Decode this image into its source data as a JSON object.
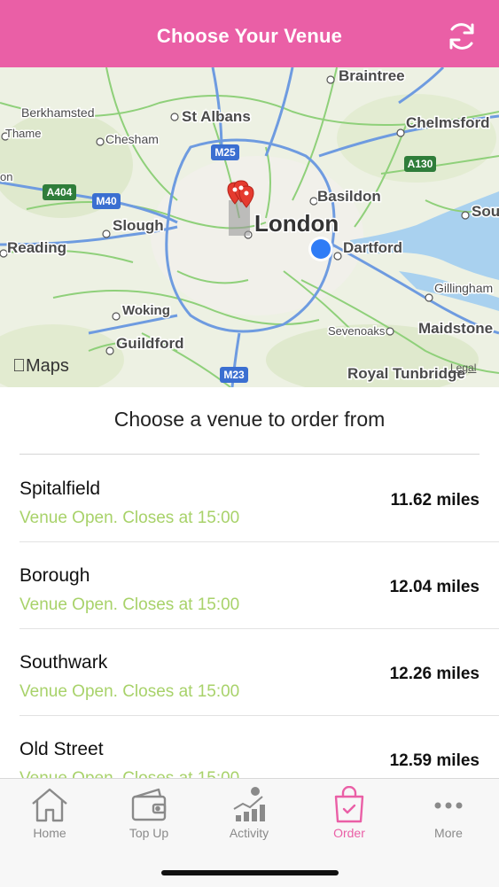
{
  "header": {
    "title": "Choose Your Venue",
    "refresh_icon": "refresh-icon"
  },
  "map": {
    "attribution": "Maps",
    "legal": "Legal",
    "labels": {
      "braintree": "Braintree",
      "berkhamsted": "Berkhamsted",
      "st_albans": "St Albans",
      "chelmsford": "Chelmsford",
      "thame": "Thame",
      "chesham": "Chesham",
      "on": "on",
      "basildon": "Basildon",
      "sou": "Sou",
      "slough": "Slough",
      "london": "London",
      "reading": "Reading",
      "dartford": "Dartford",
      "gillingham": "Gillingham",
      "woking": "Woking",
      "sevenoaks": "Sevenoaks",
      "maidstone": "Maidstone",
      "guildford": "Guildford",
      "royal_tunbridge": "Royal Tunbridge"
    },
    "shields": {
      "m25": "M25",
      "a404": "A404",
      "m40": "M40",
      "a130": "A130",
      "m23": "M23"
    }
  },
  "section_title": "Choose a venue to order from",
  "venues": [
    {
      "name": "Spitalfield",
      "status": "Venue Open. Closes at 15:00",
      "distance": "11.62 miles"
    },
    {
      "name": "Borough",
      "status": "Venue Open. Closes at 15:00",
      "distance": "12.04 miles"
    },
    {
      "name": "Southwark",
      "status": "Venue Open. Closes at 15:00",
      "distance": "12.26 miles"
    },
    {
      "name": "Old Street",
      "status": "Venue Open. Closes at 15:00",
      "distance": "12.59 miles"
    }
  ],
  "tabs": [
    {
      "label": "Home",
      "icon": "home-icon"
    },
    {
      "label": "Top Up",
      "icon": "wallet-icon"
    },
    {
      "label": "Activity",
      "icon": "activity-icon"
    },
    {
      "label": "Order",
      "icon": "shopping-bag-icon",
      "active": true
    },
    {
      "label": "More",
      "icon": "more-icon"
    }
  ],
  "colors": {
    "accent": "#ea5fa6",
    "open_status": "#a8d26a"
  }
}
